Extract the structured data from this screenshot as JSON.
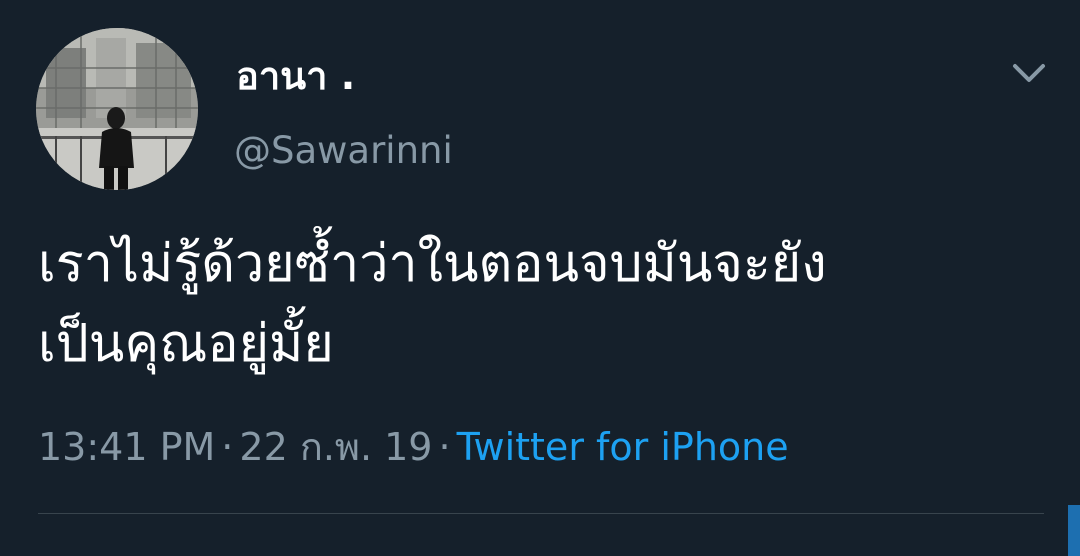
{
  "tweet": {
    "display_name": "อานา .",
    "handle": "@Sawarinni",
    "text_lines": [
      "เราไม่รู้ด้วยซ้ำว่าในตอนจบมันจะยัง",
      "เป็นคุณอยู่มั้ย"
    ],
    "time": "13:41 PM",
    "separator": "·",
    "date": "22 ก.พ. 19",
    "source": "Twitter for iPhone"
  },
  "icons": {
    "menu": "chevron-down-icon",
    "avatar": "profile-photo"
  },
  "colors": {
    "background": "#15202b",
    "primary_text": "#ffffff",
    "secondary_text": "#8899a6",
    "accent": "#1da1f2",
    "divider": "#38444d"
  }
}
